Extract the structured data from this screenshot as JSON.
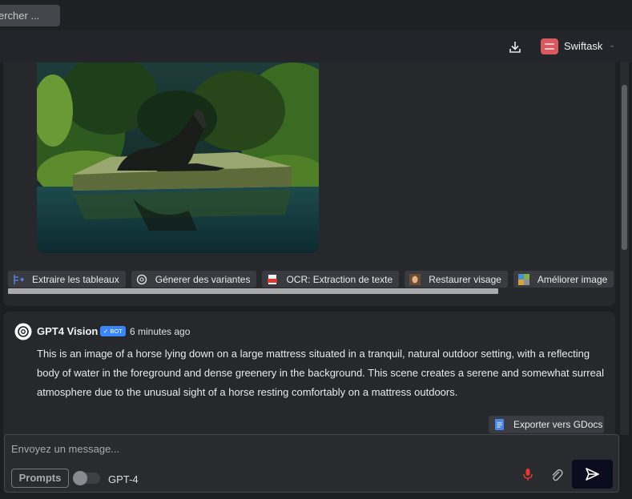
{
  "search": {
    "placeholder": "ercher ..."
  },
  "header": {
    "download_icon": "download-icon",
    "brand": "Swiftask",
    "brand_menu_icon": "chevron-down-icon"
  },
  "attachment": {
    "image_icon": "horse-on-mattress-image"
  },
  "actions": [
    {
      "label": "Extraire les tableaux",
      "icon": "table-extract-icon"
    },
    {
      "label": "Génerer des variantes",
      "icon": "openai-icon"
    },
    {
      "label": "OCR: Extraction de texte",
      "icon": "ocr-icon"
    },
    {
      "label": "Restaurer visage",
      "icon": "face-restore-icon"
    },
    {
      "label": "Améliorer image",
      "icon": "image-enhance-icon"
    }
  ],
  "message": {
    "author": "GPT4 Vision",
    "badge": "✓ BOT",
    "time": "6 minutes ago",
    "text": "This is an image of a horse lying down on a large mattress situated in a tranquil, natural outdoor setting, with a reflecting body of water in the foreground and dense greenery in the background. This scene creates a serene and somewhat surreal atmosphere due to the unusual sight of a horse resting comfortably on a mattress outdoors.",
    "export_label": "Exporter vers GDocs"
  },
  "composer": {
    "placeholder": "Envoyez un message...",
    "prompts_label": "Prompts",
    "model": "GPT-4",
    "toggle_on": false,
    "accent": "#e53935"
  }
}
